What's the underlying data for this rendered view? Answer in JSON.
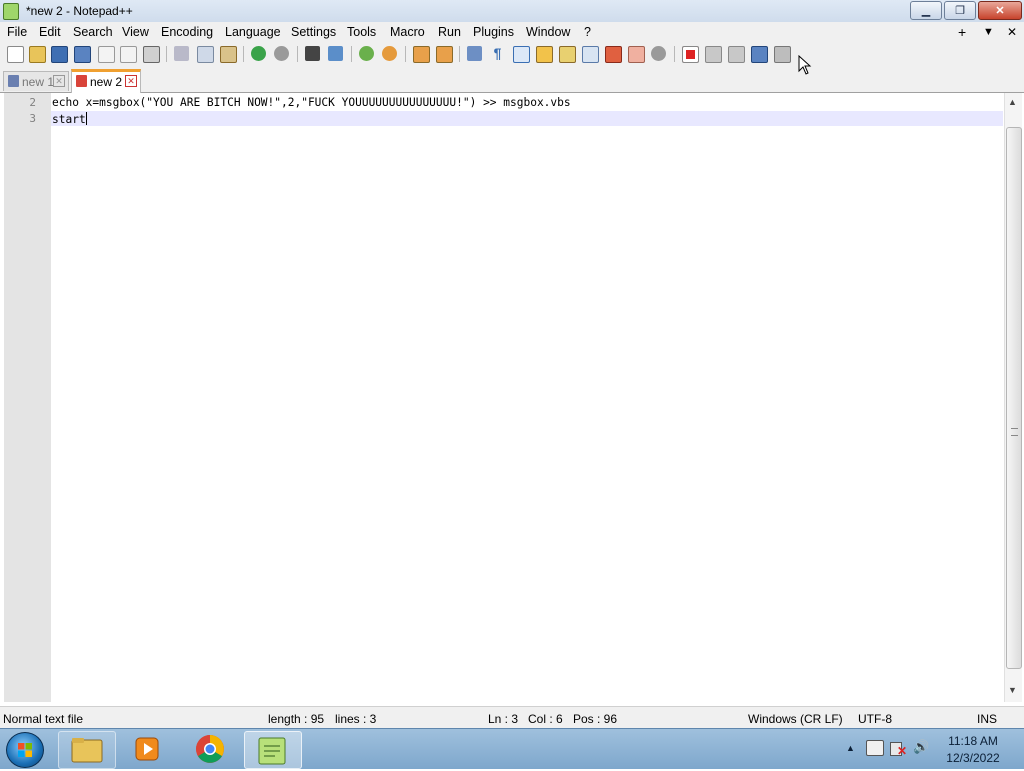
{
  "window": {
    "title": "*new 2 - Notepad++",
    "minimize": "▁",
    "maximize": "❐",
    "close": "✕"
  },
  "menubar": {
    "items": [
      "File",
      "Edit",
      "Search",
      "View",
      "Encoding",
      "Language",
      "Settings",
      "Tools",
      "Macro",
      "Run",
      "Plugins",
      "Window",
      "?"
    ],
    "right": {
      "add": "+",
      "dropdown": "▼",
      "close": "✕"
    }
  },
  "toolbar": {
    "icons": [
      "new-file",
      "open-file",
      "save",
      "save-all",
      "close",
      "close-all",
      "print",
      "cut",
      "copy",
      "paste",
      "undo",
      "redo",
      "find",
      "replace",
      "zoom-in",
      "zoom-out",
      "sync-vertical",
      "sync-horizontal",
      "word-wrap",
      "show-all-chars",
      "indent-guide",
      "udl",
      "doc-map",
      "function-list",
      "folder-workspace",
      "monitoring",
      "record-macro",
      "stop-record",
      "play-macro",
      "run-macro-multiple",
      "save-macro"
    ]
  },
  "tabs": [
    {
      "label": "new 1",
      "active": false,
      "close": "✕"
    },
    {
      "label": "new 2",
      "active": true,
      "close": "✕"
    }
  ],
  "editor": {
    "lines": [
      {
        "number": "2",
        "text": "echo x=msgbox(\"YOU ARE BITCH NOW!\",2,\"FUCK YOUUUUUUUUUUUUUUU!\") >> msgbox.vbs"
      },
      {
        "number": "3",
        "text": "start"
      }
    ]
  },
  "statusbar": {
    "file_type": "Normal text file",
    "length": "length : 95",
    "lines": "lines : 3",
    "ln": "Ln : 3",
    "col": "Col : 6",
    "pos": "Pos : 96",
    "eol": "Windows (CR LF)",
    "encoding": "UTF-8",
    "mode": "INS"
  },
  "taskbar": {
    "apps": [
      "windows-explorer",
      "windows-media-player",
      "google-chrome",
      "notepad-plus-plus"
    ],
    "tray": {
      "show_hidden": "▲",
      "volume": "🔊"
    },
    "clock": {
      "time": "11:18 AM",
      "date": "12/3/2022"
    }
  },
  "colors": {
    "tab_accent": "#f0a030",
    "current_line": "#e8e8ff",
    "gutter": "#e4e4e4",
    "taskbar": "#8fb3d6"
  }
}
